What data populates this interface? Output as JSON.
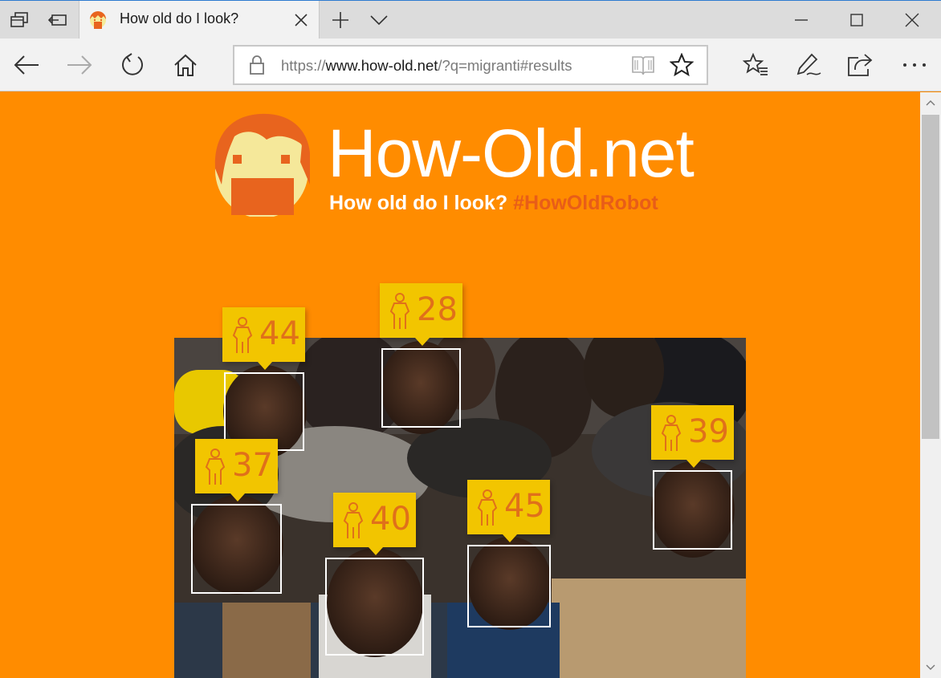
{
  "browser": {
    "tab_title": "How old do I look?",
    "url_prefix": "https://",
    "url_host": "www.how-old.net",
    "url_suffix": "/?q=migranti#results"
  },
  "site": {
    "title": "How-Old.net",
    "tagline": "How old do I look?",
    "hashtag": "#HowOldRobot"
  },
  "faces": [
    {
      "age": "44",
      "gender_icon": "female-icon"
    },
    {
      "age": "28",
      "gender_icon": "female-icon"
    },
    {
      "age": "37",
      "gender_icon": "female-icon"
    },
    {
      "age": "40",
      "gender_icon": "female-icon"
    },
    {
      "age": "45",
      "gender_icon": "female-icon"
    },
    {
      "age": "39",
      "gender_icon": "female-icon"
    }
  ],
  "colors": {
    "page_bg": "#ff8c00",
    "tag_bg": "#f2c500",
    "tag_text": "#e0701a",
    "hashtag": "#e85d18"
  }
}
